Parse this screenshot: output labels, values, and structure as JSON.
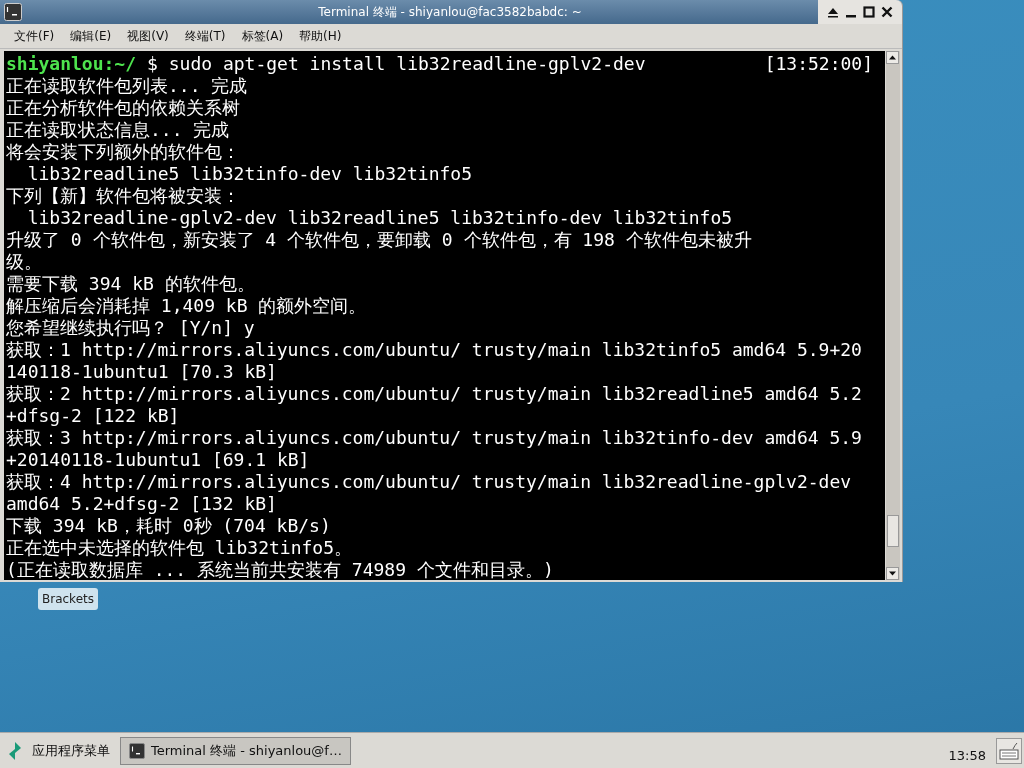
{
  "window": {
    "title": "Terminal 终端 - shiyanlou@fac3582babdc: ~"
  },
  "menu": [
    "文件(F)",
    "编辑(E)",
    "视图(V)",
    "终端(T)",
    "标签(A)",
    "帮助(H)"
  ],
  "terminal": {
    "prompt": {
      "user_path": "shiyanlou:~/",
      "command": "$ sudo apt-get install lib32readline-gplv2-dev",
      "time": "[13:52:00]"
    },
    "lines": [
      "正在读取软件包列表... 完成",
      "正在分析软件包的依赖关系树",
      "正在读取状态信息... 完成",
      "将会安装下列额外的软件包：",
      "  lib32readline5 lib32tinfo-dev lib32tinfo5",
      "下列【新】软件包将被安装：",
      "  lib32readline-gplv2-dev lib32readline5 lib32tinfo-dev lib32tinfo5",
      "升级了 0 个软件包，新安装了 4 个软件包，要卸载 0 个软件包，有 198 个软件包未被升",
      "级。",
      "需要下载 394 kB 的软件包。",
      "解压缩后会消耗掉 1,409 kB 的额外空间。",
      "您希望继续执行吗？ [Y/n] y",
      "获取：1 http://mirrors.aliyuncs.com/ubuntu/ trusty/main lib32tinfo5 amd64 5.9+20",
      "140118-1ubuntu1 [70.3 kB]",
      "获取：2 http://mirrors.aliyuncs.com/ubuntu/ trusty/main lib32readline5 amd64 5.2",
      "+dfsg-2 [122 kB]",
      "获取：3 http://mirrors.aliyuncs.com/ubuntu/ trusty/main lib32tinfo-dev amd64 5.9",
      "+20140118-1ubuntu1 [69.1 kB]",
      "获取：4 http://mirrors.aliyuncs.com/ubuntu/ trusty/main lib32readline-gplv2-dev",
      "amd64 5.2+dfsg-2 [132 kB]",
      "下载 394 kB，耗时 0秒 (704 kB/s)",
      "正在选中未选择的软件包 lib32tinfo5。",
      "(正在读取数据库 ... 系统当前共安装有 74989 个文件和目录。)"
    ]
  },
  "desktop_icons": [
    {
      "label": "Brackets"
    }
  ],
  "taskbar": {
    "app_menu": "应用程序菜单",
    "tasks": [
      {
        "label": "Terminal 终端 - shiyanlou@f…",
        "selected": true
      }
    ],
    "clock": "13:58"
  }
}
